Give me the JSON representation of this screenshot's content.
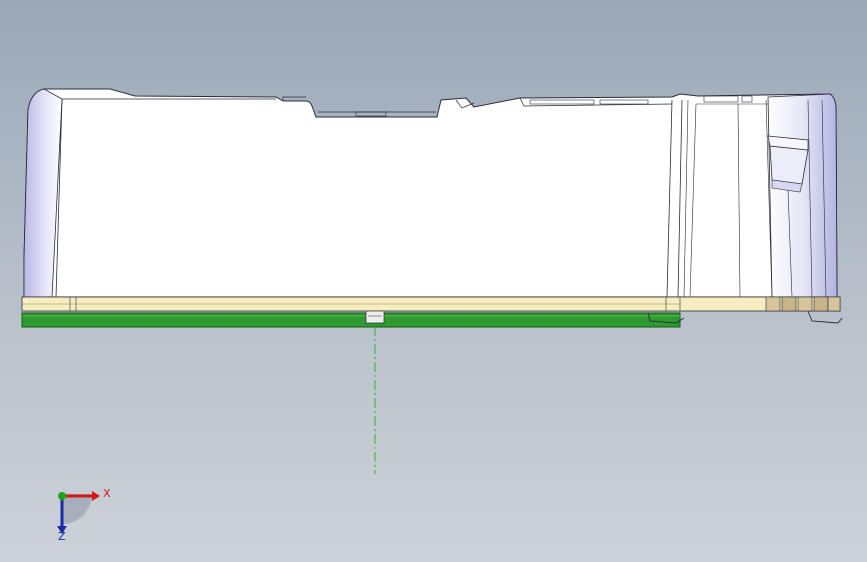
{
  "viewport": {
    "background_top": "#9aa8b8",
    "background_bottom": "#cdd2d8"
  },
  "model": {
    "housing_color": "#ffffff",
    "housing_shade": "#c9c9ee",
    "edge_color": "#2a2a3a",
    "rail_color": "#f6eec0",
    "board_color": "#2f9a2f",
    "terminal_color": "#d6c49a",
    "centerline_color": "#2bb52b"
  },
  "triad": {
    "x_label": "X",
    "z_label": "Z",
    "x_color": "#d01818",
    "y_color": "#1aa81a",
    "z_color": "#1a2aa8"
  }
}
